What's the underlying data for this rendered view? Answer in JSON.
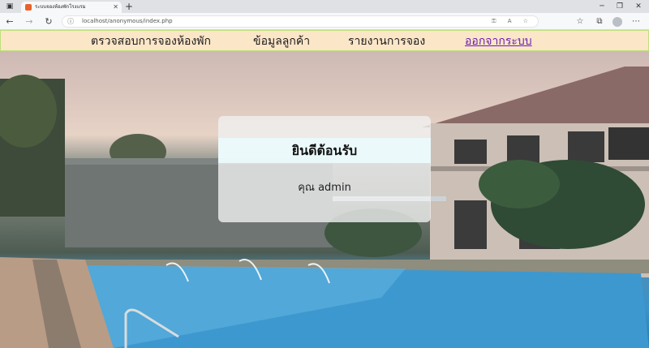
{
  "browser": {
    "tab_title": "ระบบจองห้องพักโรงแรม",
    "url": "localhost/anonymous/index.php"
  },
  "nav": {
    "items": [
      {
        "label": "ตรวจสอบการจองห้องพัก"
      },
      {
        "label": "ข้อมูลลูกค้า"
      },
      {
        "label": "รายงานการจอง"
      },
      {
        "label": "ออกจากระบบ"
      }
    ]
  },
  "welcome": {
    "title": "ยินดีต้อนรับ",
    "user_line": "คุณ admin"
  },
  "colors": {
    "nav_bg": "#fbe6c8",
    "nav_border": "#bfe07a",
    "logout_link": "#6a1fb3",
    "pool": "#3b92c9"
  }
}
